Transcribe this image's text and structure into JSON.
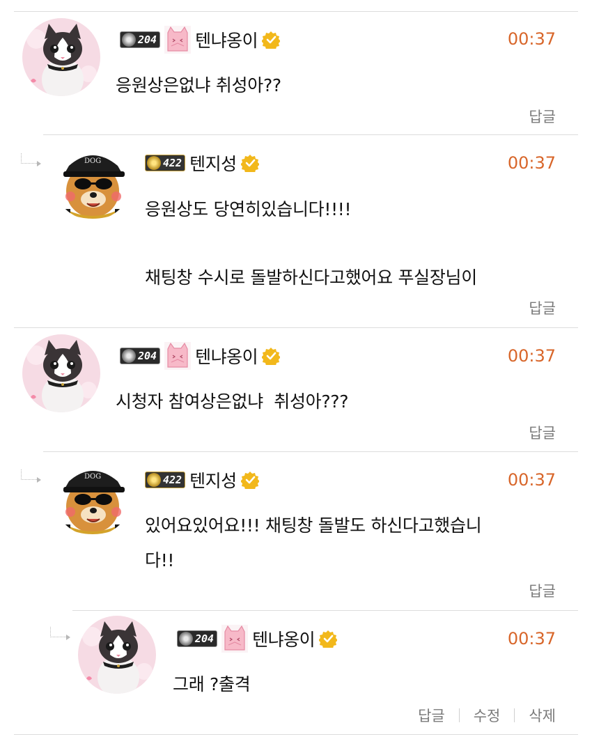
{
  "comments": [
    {
      "level": "204",
      "nickname": "텐냐옹이",
      "time": "00:37",
      "text": "응원상은없냐 취성아??",
      "reply_label": "답글"
    },
    {
      "level": "422",
      "nickname": "텐지성",
      "time": "00:37",
      "text_line1": "응원상도 당연히있습니다!!!!",
      "text_line2": "채팅창 수시로 돌발하신다고했어요 푸실장님이",
      "reply_label": "답글"
    },
    {
      "level": "204",
      "nickname": "텐냐옹이",
      "time": "00:37",
      "text": "시청자 참여상은없냐  취성아???",
      "reply_label": "답글"
    },
    {
      "level": "422",
      "nickname": "텐지성",
      "time": "00:37",
      "text_line1": "있어요있어요!!! 채팅창 돌발도 하신다고했습니",
      "text_line2": "다!!",
      "reply_label": "답글"
    },
    {
      "level": "204",
      "nickname": "텐냐옹이",
      "time": "00:37",
      "text": "그래 ?출격",
      "reply_label": "답글",
      "edit_label": "수정",
      "delete_label": "삭제"
    }
  ],
  "colors": {
    "time": "#d8662a",
    "divider": "#dcdcdc",
    "verified": "#f2b81b"
  }
}
